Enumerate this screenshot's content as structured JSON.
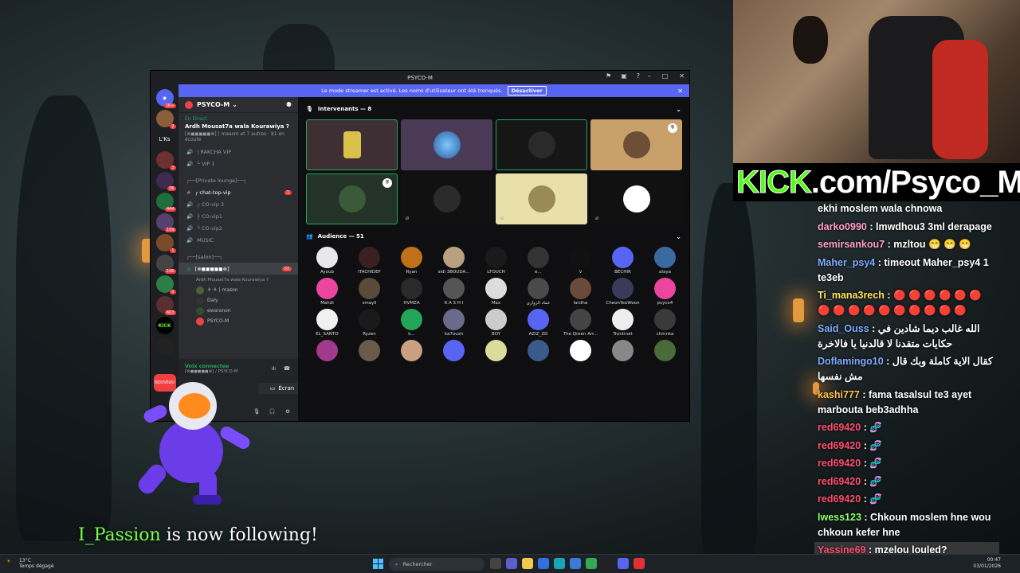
{
  "discord": {
    "window_title": "PSYCO-M",
    "banner_text": "Le mode streamer est activé. Les noms d'utilisateur ont été tronqués.",
    "banner_button": "Désactiver",
    "server_name": "PSYCO-M",
    "live_label": "En Direct",
    "live_title": "Ardh Mousat7a wala Kourawiya ?",
    "live_sub": "[⊗◼◼◼◼◼⊗] | maasm et 7 autres",
    "live_listening": "81 en écoute",
    "guild_label_lks": "L'Ks",
    "guild_badges": [
      "1K+",
      "2",
      "3",
      "36",
      "1",
      "444",
      "109",
      "1",
      "2",
      "140",
      "603"
    ],
    "guild_kick_label": "KICK",
    "guild_new_label": "NOUVEAU",
    "channels": [
      {
        "label": "| RAKCHA VIP",
        "badge": ""
      },
      {
        "label": "└ VIP 1",
        "badge": ""
      },
      {
        "label": "┌──[Private lounge]──┐",
        "badge": ""
      },
      {
        "label": "┌ chat-top-vip",
        "badge": "1"
      },
      {
        "label": "┌ CO-vip 3",
        "badge": ""
      },
      {
        "label": "├ CO-vip1",
        "badge": ""
      },
      {
        "label": "└ CO-vip2",
        "badge": ""
      },
      {
        "label": "MUSIC",
        "badge": ""
      },
      {
        "label": "┌──[salon]──┐",
        "badge": ""
      }
    ],
    "active_channel": {
      "label": "[⊗◼◼◼◼◼⊗]",
      "badge": "33",
      "sub": "Ardh Mousat7a wala Kourawiya ?"
    },
    "channel_members": [
      "⚘·⚘ | mason",
      "Daly",
      "ewaranon",
      "PSYCO-M"
    ],
    "voice_status": "Voix connectée",
    "voice_channel": "[⊗◼◼◼◼◼⊗] / PSYCO-M",
    "screen_button": "Écran",
    "speakers_header": "Intervenants — 8",
    "audience_header": "Audience — 51",
    "audience": [
      "Ayoub",
      "iTACHIDEF",
      "Ryan",
      "sidi 3BOUDA...",
      "LFOUCH",
      "e...",
      "V",
      "BECHIR",
      "alaya",
      "Mahdi",
      "smayli",
      "HVMZA",
      "K A S H I",
      "Max",
      "عماد الزواري",
      "lardha",
      "CheonYeoWoon",
      "psyco4",
      "EL_SANTO",
      "Ryzen",
      "k...",
      "ka7oush",
      "BOY",
      "AZIZ_ZD",
      "The Qreen Arr...",
      "Trontinet",
      "chmnka",
      "",
      "",
      "",
      "",
      "",
      "",
      "",
      "",
      ""
    ]
  },
  "stream": {
    "kick_green": "KICK",
    "kick_white": ".com/Psyco_M",
    "follow_user": "I_Passion",
    "follow_text": " is now following!"
  },
  "chat": [
    {
      "user": "",
      "text": "ekhi moslem wala chnowa",
      "color": "#ffffff"
    },
    {
      "user": "darko0990",
      "text": ": lmwdhou3 3ml derapage",
      "color": "#ff9ecf"
    },
    {
      "user": "semirsankou7",
      "text": ": mzltou 😁 😁 😁",
      "color": "#ff9ecf"
    },
    {
      "user": "Maher_psy4",
      "text": ": timeout Maher_psy4 1 te3eb",
      "color": "#7fa8ff"
    },
    {
      "user": "Ti_mana3rech",
      "text": ": 🔴 🔴 🔴 🔴 🔴 🔴 🔴 🔴 🔴 🔴 🔴 🔴 🔴 🔴 🔴 🔴",
      "color": "#ffe25a"
    },
    {
      "user": "Said_Ouss",
      "text": ": الله غالب ديما شادين في حكايات متقدنا لا قالدنيا يا فالاخرة",
      "color": "#7fa8ff"
    },
    {
      "user": "Doflamingo10",
      "text": ": كقال الاية كاملة وبك قال مش نفسها",
      "color": "#7fa8ff"
    },
    {
      "user": "kashi777",
      "text": ": fama tasalsul te3 ayet marbouta beb3adhha",
      "color": "#ffc04d"
    },
    {
      "user": "red69420",
      "text": ": 🧬",
      "color": "#ff4d6d"
    },
    {
      "user": "red69420",
      "text": ": 🧬",
      "color": "#ff4d6d"
    },
    {
      "user": "red69420",
      "text": ": 🧬",
      "color": "#ff4d6d"
    },
    {
      "user": "red69420",
      "text": ": 🧬",
      "color": "#ff4d6d"
    },
    {
      "user": "red69420",
      "text": ": 🧬",
      "color": "#ff4d6d"
    },
    {
      "user": "lwess123",
      "text": ": Chkoun moslem hne wou chkoun kefer hne",
      "color": "#8dff6b"
    },
    {
      "user": "Yassine69",
      "text": ": mzelou louled?",
      "color": "#ff4d6d"
    }
  ],
  "taskbar": {
    "temp": "13°C",
    "weather": "Temps dégagé",
    "search": "Rechercher",
    "time": "00:47",
    "date": "03/01/2026"
  },
  "colors": {
    "accent": "#5865f2",
    "kick_green": "#53fc18",
    "online": "#23a55a"
  }
}
